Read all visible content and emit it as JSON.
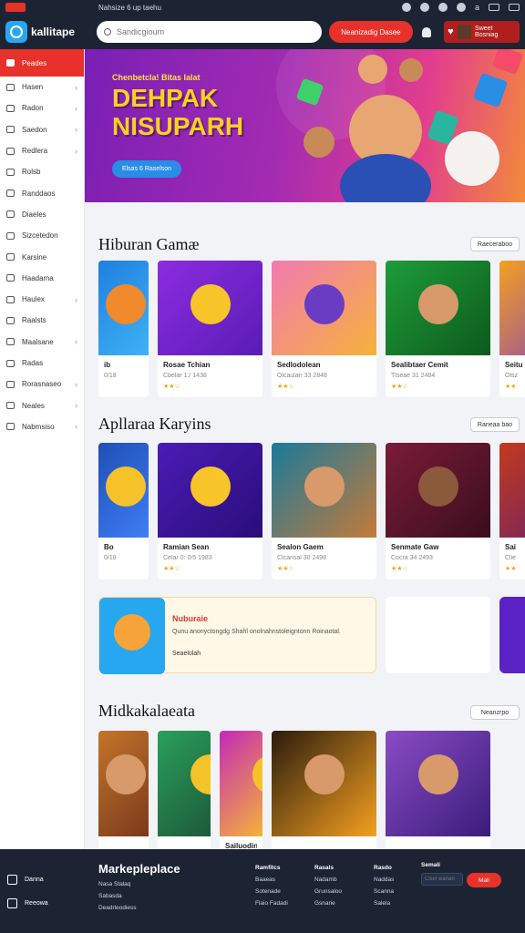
{
  "status": {
    "strip_text": "Nahsize 6 up taehu",
    "indicator": "a"
  },
  "header": {
    "brand": "kallitape",
    "search_placeholder": "Sandicgioum",
    "cta_label": "Neanizadig Dasee",
    "user_name": "Sweet Bosniag"
  },
  "sidebar": {
    "items": [
      {
        "label": "Peades",
        "chevron": false
      },
      {
        "label": "Hasen",
        "chevron": true
      },
      {
        "label": "Radon",
        "chevron": true
      },
      {
        "label": "Saedon",
        "chevron": true
      },
      {
        "label": "Redlera",
        "chevron": true
      },
      {
        "label": "Rolsb",
        "chevron": false
      },
      {
        "label": "Randdaos",
        "chevron": false
      },
      {
        "label": "Diaeles",
        "chevron": false
      },
      {
        "label": "Sizcetedon",
        "chevron": false
      },
      {
        "label": "Karsine",
        "chevron": false
      },
      {
        "label": "Haadama",
        "chevron": false
      },
      {
        "label": "Haulex",
        "chevron": true
      },
      {
        "label": "Raalsts",
        "chevron": false
      },
      {
        "label": "Maalsane",
        "chevron": true
      },
      {
        "label": "Radas",
        "chevron": false
      },
      {
        "label": "Rorasnaseo",
        "chevron": true
      },
      {
        "label": "Neales",
        "chevron": true
      },
      {
        "label": "Nabmsiso",
        "chevron": true
      }
    ]
  },
  "hero": {
    "kicker": "Chenbetcla! Bitas lalat",
    "title": "DEHPAK NISUPARH",
    "button": "Elsas 6 Raselson"
  },
  "sections": [
    {
      "title": "Hiburan Gamæ",
      "see_all": "Raeceraboo",
      "cards": [
        {
          "name": "ib",
          "meta": "0/18",
          "stars": "",
          "c1": "#1e7fe0",
          "c2": "#3fb2f5",
          "face": "#f08a2c"
        },
        {
          "name": "Rosae Tchian",
          "meta": "Cbelar 1:/ 1438",
          "stars": "★★☆",
          "c1": "#8b2ce0",
          "c2": "#5a1cb5",
          "face": "#f7c52a"
        },
        {
          "name": "Sedlodolean",
          "meta": "Olcaulan 33 2848",
          "stars": "★★☆",
          "c1": "#f27ab2",
          "c2": "#f5b23a",
          "face": "#6a3cc4"
        },
        {
          "name": "Sealibtaer Cemit",
          "meta": "Tlseae 31 2484",
          "stars": "★★☆",
          "c1": "#1e9c3a",
          "c2": "#0d5a1c",
          "face": "#d89a6a"
        },
        {
          "name": "Seitu",
          "meta": "Olsz",
          "stars": "★★",
          "c1": "#f5a020",
          "c2": "#7a3cc4",
          "face": "#8a4cc4"
        }
      ]
    },
    {
      "title": "Apllaraa Karyins",
      "see_all": "Raneaa bao",
      "cards": [
        {
          "name": "Bo",
          "meta": "0/18",
          "stars": "",
          "c1": "#1e4fb5",
          "c2": "#3f7ef5",
          "face": "#f5c22a"
        },
        {
          "name": "Ramian Sean",
          "meta": "Celar 0: 0/5 1983",
          "stars": "★★☆",
          "c1": "#4a1cb5",
          "c2": "#2a0d7a",
          "face": "#f7c52a"
        },
        {
          "name": "Sealon Gaem",
          "meta": "Clcansal 30 2498",
          "stars": "★★☆",
          "c1": "#1a7a9c",
          "c2": "#c47a3a",
          "face": "#d89a6a"
        },
        {
          "name": "Senmate Gaw",
          "meta": "Cocra 34 2493",
          "stars": "★★☆",
          "c1": "#7a1c3a",
          "c2": "#3a0d1c",
          "face": "#8a5a3a"
        },
        {
          "name": "Sai",
          "meta": "Clie",
          "stars": "★★",
          "c1": "#c43a1c",
          "c2": "#5a1c7a",
          "face": "#d89a6a"
        }
      ]
    },
    {
      "title": "Midkakalaeata",
      "see_all": "Neanzrpo",
      "cards": [
        {
          "name": "",
          "meta": "",
          "stars": "",
          "c1": "#c4742a",
          "c2": "#7a3a1c",
          "face": "#d89a6a"
        },
        {
          "name": "",
          "meta": "",
          "stars": "",
          "c1": "#2aa05a",
          "c2": "#1c5a3a",
          "face": "#f5c22a"
        },
        {
          "name": "Sailuodin Gam",
          "meta": "",
          "stars": "",
          "c1": "#c42ab5",
          "c2": "#f5b23a",
          "face": "#f5c22a"
        },
        {
          "name": "",
          "meta": "",
          "stars": "",
          "c1": "#2a1c0d",
          "c2": "#f5a020",
          "face": "#d89a6a"
        },
        {
          "name": "",
          "meta": "",
          "stars": "",
          "c1": "#8a4cc4",
          "c2": "#3a1c7a",
          "face": "#d89a6a"
        }
      ]
    }
  ],
  "promo": {
    "title": "Nuburaie",
    "description": "Qunu anonyctongdg Shahl onolnahnstoleigntonn Roinaotal.",
    "link": "Seaelolah"
  },
  "footer": {
    "side_items": [
      "Danna",
      "Reeowa"
    ],
    "title": "Markepleplace",
    "left_links": [
      "Nasa Stalaq",
      "Sabasda",
      "Deadrleodiess"
    ],
    "columns": [
      {
        "heading": "Ramfitcs",
        "links": [
          "Baaeas",
          "Sotenade",
          "Flaio Fadadi"
        ]
      },
      {
        "heading": "Rasals",
        "links": [
          "Nadamb",
          "Grunsaloo",
          "Gsnarie"
        ]
      },
      {
        "heading": "Rasdo",
        "links": [
          "Naddas",
          "Scanna",
          "Salela"
        ]
      }
    ],
    "signup_label": "Semali",
    "input_placeholder": "Clsel wanan",
    "button": "Mall"
  }
}
